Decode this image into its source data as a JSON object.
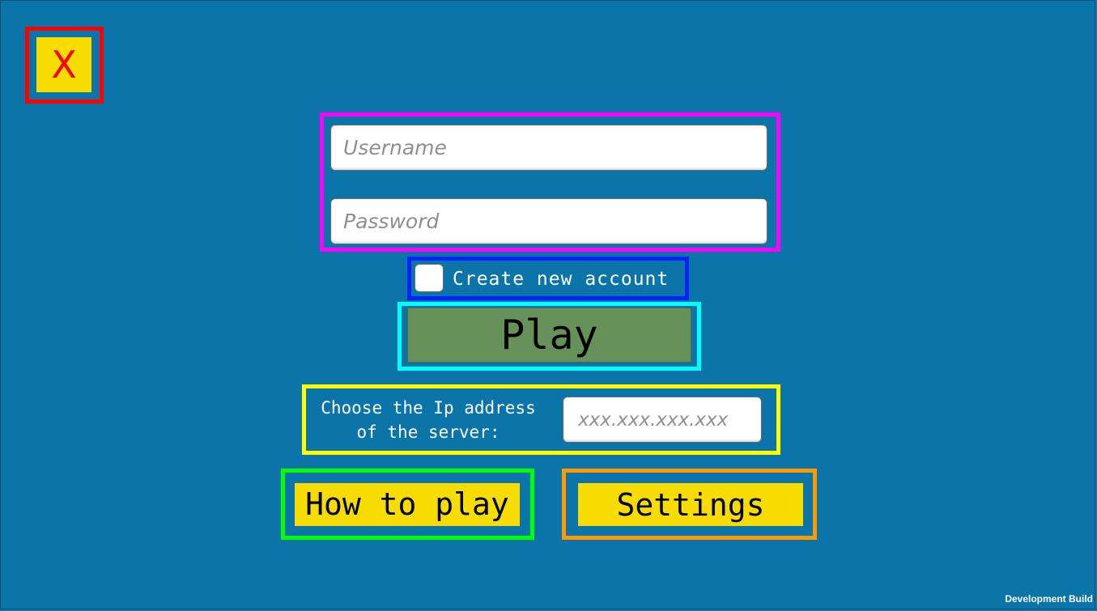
{
  "close": {
    "label": "X"
  },
  "credentials": {
    "username_placeholder": "Username",
    "username_value": "",
    "password_placeholder": "Password",
    "password_value": ""
  },
  "create_account": {
    "label": "Create new account",
    "checked": false
  },
  "play": {
    "label": "Play"
  },
  "server": {
    "label": "Choose the Ip address\nof the server:",
    "ip_placeholder": "xxx.xxx.xxx.xxx",
    "ip_value": ""
  },
  "how_to_play": {
    "label": "How to play"
  },
  "settings": {
    "label": "Settings"
  },
  "footer": {
    "build_label": "Development Build"
  },
  "colors": {
    "background": "#0b74a9",
    "button_yellow": "#f7dc00",
    "play_green": "#66915a",
    "close_red": "#ff0000"
  }
}
